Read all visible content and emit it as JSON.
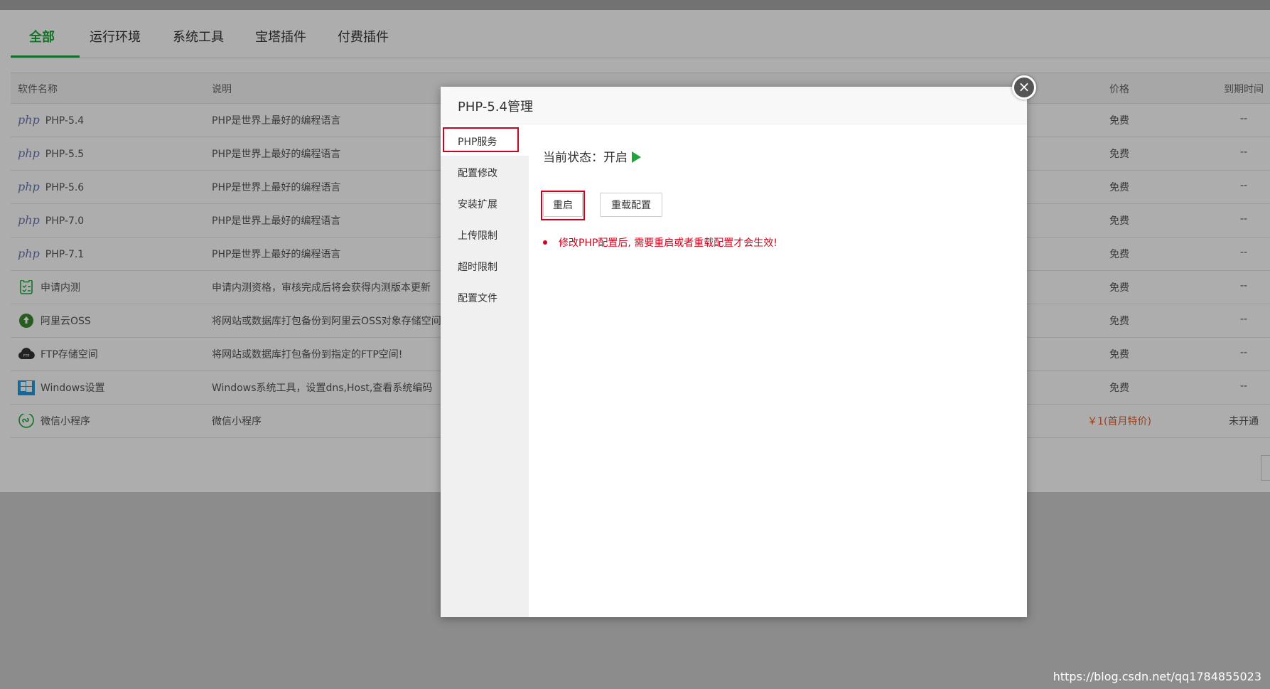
{
  "tabs": [
    "全部",
    "运行环境",
    "系统工具",
    "宝塔插件",
    "付费插件"
  ],
  "table": {
    "headers": {
      "name": "软件名称",
      "desc": "说明",
      "price": "价格",
      "expire": "到期时间"
    },
    "rows": [
      {
        "icon": "php-logo-icon",
        "logo": "php",
        "name": "PHP-5.4",
        "desc": "PHP是世界上最好的编程语言",
        "price": "免费",
        "expire": "--"
      },
      {
        "icon": "php-logo-icon",
        "logo": "php",
        "name": "PHP-5.5",
        "desc": "PHP是世界上最好的编程语言",
        "price": "免费",
        "expire": "--"
      },
      {
        "icon": "php-logo-icon",
        "logo": "php",
        "name": "PHP-5.6",
        "desc": "PHP是世界上最好的编程语言",
        "price": "免费",
        "expire": "--"
      },
      {
        "icon": "php-logo-icon",
        "logo": "php",
        "name": "PHP-7.0",
        "desc": "PHP是世界上最好的编程语言",
        "price": "免费",
        "expire": "--"
      },
      {
        "icon": "php-logo-icon",
        "logo": "php",
        "name": "PHP-7.1",
        "desc": "PHP是世界上最好的编程语言",
        "price": "免费",
        "expire": "--"
      },
      {
        "icon": "clipboard-check-icon",
        "name": "申请内测",
        "desc": "申请内测资格，审核完成后将会获得内测版本更新",
        "price": "免费",
        "expire": "--"
      },
      {
        "icon": "aliyun-oss-icon",
        "name": "阿里云OSS",
        "desc": "将网站或数据库打包备份到阿里云OSS对象存储空间",
        "price": "免费",
        "expire": "--"
      },
      {
        "icon": "ftp-cloud-icon",
        "name": "FTP存储空间",
        "desc": "将网站或数据库打包备份到指定的FTP空间!",
        "price": "免费",
        "expire": "--"
      },
      {
        "icon": "windows-icon",
        "name": "Windows设置",
        "desc": "Windows系统工具，设置dns,Host,查看系统编码",
        "price": "免费",
        "expire": "--"
      },
      {
        "icon": "wechat-miniprogram-icon",
        "name": "微信小程序",
        "desc": "微信小程序",
        "price": "￥1(首月特价)",
        "price_paid": true,
        "expire": "未开通"
      }
    ]
  },
  "modal": {
    "title": "PHP-5.4管理",
    "side_items": [
      "PHP服务",
      "配置修改",
      "安装扩展",
      "上传限制",
      "超时限制",
      "配置文件"
    ],
    "status_label": "当前状态：开启",
    "restart_label": "重启",
    "reload_label": "重载配置",
    "warning": "修改PHP配置后, 需要重启或者重载配置才会生效!"
  },
  "close_icon": "×",
  "watermark": "https://blog.csdn.net/qq1784855023",
  "colors": {
    "accent": "#20a53a",
    "warning": "#d0021b",
    "paid_price": "#ee5a24"
  }
}
